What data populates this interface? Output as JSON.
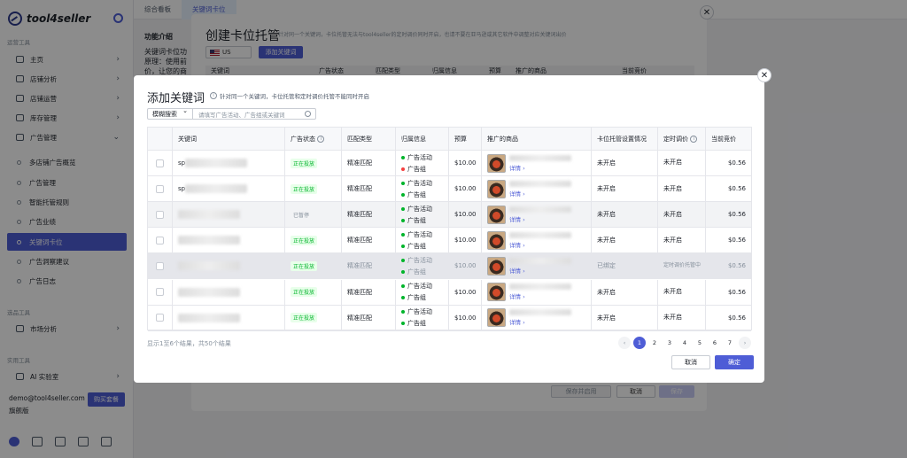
{
  "sidebar": {
    "logo": "tool4seller",
    "sections": {
      "ops": "运营工具",
      "market": "选品工具",
      "practical": "实用工具"
    },
    "items": [
      {
        "label": "主页"
      },
      {
        "label": "店铺分析"
      },
      {
        "label": "店铺运营"
      },
      {
        "label": "库存管理"
      },
      {
        "label": "广告管理"
      }
    ],
    "subitems": [
      {
        "label": "多店铺广告概览"
      },
      {
        "label": "广告管理"
      },
      {
        "label": "智能托管规则"
      },
      {
        "label": "广告业绩"
      },
      {
        "label": "关键词卡位"
      },
      {
        "label": "广告洞察建议"
      },
      {
        "label": "广告日志"
      }
    ],
    "market_item": "市场分析",
    "ai_item": "AI 实验室",
    "email": "demo@tool4seller.com",
    "edition": "旗舰版",
    "buy_button": "购买套餐"
  },
  "tabs": [
    {
      "label": "综合看板"
    },
    {
      "label": "关键词卡位"
    }
  ],
  "background": {
    "section_title": "功能介绍",
    "line1": "关键词卡位功",
    "line2": "原理：使用前",
    "line3": "价，让您的商"
  },
  "back_modal": {
    "title": "创建卡位托管",
    "hint": "针对同一个关键词，卡位托管无法与tool4seller的定时调价同时开启，也请不要在亚马逊或其它软件中调整对应关键词出价",
    "marketplace": "US",
    "add_keyword": "添加关键词",
    "columns": [
      "关键词",
      "广告状态",
      "匹配类型",
      "归属信息",
      "预算",
      "推广的商品",
      "当前竞价"
    ],
    "save_enable": "保存并启用",
    "cancel": "取消",
    "save": "保存"
  },
  "front_modal": {
    "title": "添加关键词",
    "hint": "针对同一个关键词，卡位托管和定时调价托管不能同时开启",
    "search_mode": "模糊搜索",
    "search_placeholder": "请填写广告活动、广告组或关键词",
    "columns": [
      "关键词",
      "广告状态",
      "匹配类型",
      "归属信息",
      "预算",
      "推广的商品",
      "卡位托管设置情况",
      "定时调价",
      "当前竞价"
    ],
    "rows": [
      {
        "keyword": "sp",
        "status": "正在投放",
        "match": "精准匹配",
        "campaign": "广告活动",
        "group": "广告组",
        "group_red": true,
        "budget": "$10.00",
        "link": "详情",
        "bid_mgmt": "未开启",
        "timed": "未开启",
        "bid": "$0.56"
      },
      {
        "keyword": "sp",
        "status": "正在投放",
        "match": "精准匹配",
        "campaign": "广告活动",
        "group": "广告组",
        "group_red": false,
        "budget": "$10.00",
        "link": "详情",
        "bid_mgmt": "未开启",
        "timed": "未开启",
        "bid": "$0.56"
      },
      {
        "keyword": "",
        "status": "已暂停",
        "match": "精准匹配",
        "campaign": "广告活动",
        "group": "广告组",
        "group_red": false,
        "budget": "$10.00",
        "link": "详情",
        "bid_mgmt": "未开启",
        "timed": "未开启",
        "bid": "$0.56"
      },
      {
        "keyword": "",
        "status": "正在投放",
        "match": "精准匹配",
        "campaign": "广告活动",
        "group": "广告组",
        "group_red": false,
        "budget": "$10.00",
        "link": "详情",
        "bid_mgmt": "未开启",
        "timed": "未开启",
        "bid": "$0.56"
      },
      {
        "keyword": "",
        "status": "正在投放",
        "match": "精准匹配",
        "campaign": "广告活动",
        "group": "广告组",
        "group_red": false,
        "budget": "$10.00",
        "link": "详情",
        "bid_mgmt": "已绑定",
        "timed": "定时调价托管中",
        "bid": "$0.56"
      },
      {
        "keyword": "",
        "status": "正在投放",
        "match": "精准匹配",
        "campaign": "广告活动",
        "group": "广告组",
        "group_red": false,
        "budget": "$10.00",
        "link": "详情",
        "bid_mgmt": "未开启",
        "timed": "未开启",
        "bid": "$0.56"
      },
      {
        "keyword": "",
        "status": "正在投放",
        "match": "精准匹配",
        "campaign": "广告活动",
        "group": "广告组",
        "group_red": false,
        "budget": "$10.00",
        "link": "详情",
        "bid_mgmt": "未开启",
        "timed": "未开启",
        "bid": "$0.56"
      }
    ],
    "summary": "显示1至6个结果，共50个结果",
    "pages": [
      "1",
      "2",
      "3",
      "4",
      "5",
      "6",
      "7"
    ],
    "prev": "‹",
    "next": "›",
    "cancel": "取消",
    "ok": "确定"
  }
}
